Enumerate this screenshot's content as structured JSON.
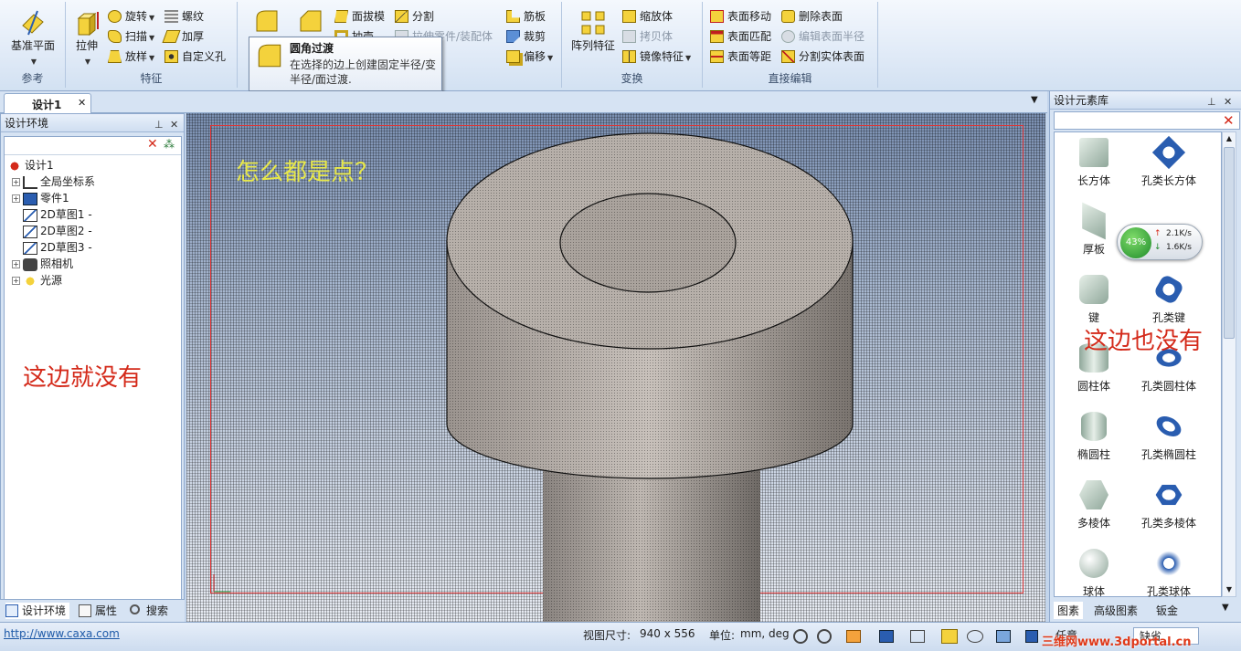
{
  "ribbon": {
    "groups": [
      {
        "label": "参考"
      },
      {
        "label": "特征"
      },
      {
        "label": "变换"
      },
      {
        "label": "直接编辑"
      }
    ],
    "reference_btn": "基准平面",
    "extrude_btn": "拉伸",
    "rotate_btn": "旋转",
    "sweep_btn": "扫描",
    "loft_btn": "放样",
    "thread_btn": "螺纹",
    "thicken_btn": "加厚",
    "custom_hole_btn": "自定义孔",
    "draft_btn": "面拔模",
    "split_btn": "分割",
    "extract_btn": "抽壳",
    "stretch_part_btn": "拉伸零件/装配体",
    "rib_btn": "筋板",
    "trim_btn": "裁剪",
    "offset_btn": "偏移",
    "pattern_btn": "阵列特征",
    "scale_btn": "缩放体",
    "copy_btn": "拷贝体",
    "mirror_btn": "镜像特征",
    "face_move_btn": "表面移动",
    "face_match_btn": "表面匹配",
    "face_offset_btn": "表面等距",
    "delete_face_btn": "删除表面",
    "edit_radius_btn": "编辑表面半径",
    "split_solid_btn": "分割实体表面"
  },
  "tooltip": {
    "title": "圆角过渡",
    "description": "在选择的边上创建固定半径/变半径/面过渡."
  },
  "doc_tab": {
    "label": "设计1"
  },
  "left_panel": {
    "title": "设计环境",
    "tree": [
      {
        "label": "设计1"
      },
      {
        "label": "全局坐标系"
      },
      {
        "label": "零件1"
      },
      {
        "label": "2D草图1 -"
      },
      {
        "label": "2D草图2 -"
      },
      {
        "label": "2D草图3 -"
      },
      {
        "label": "照相机"
      },
      {
        "label": "光源"
      }
    ],
    "annotation": "这边就没有",
    "bottom_tabs": [
      {
        "label": "设计环境"
      },
      {
        "label": "属性"
      },
      {
        "label": "搜索"
      }
    ]
  },
  "viewport": {
    "annotation": "怎么都是点？"
  },
  "right_panel": {
    "title": "设计元素库",
    "items": [
      {
        "label": "长方体"
      },
      {
        "label": "孔类长方体"
      },
      {
        "label": "厚板"
      },
      {
        "label": "键"
      },
      {
        "label": "孔类键"
      },
      {
        "label": "圆柱体"
      },
      {
        "label": "孔类圆柱体"
      },
      {
        "label": "椭圆柱"
      },
      {
        "label": "孔类椭圆柱"
      },
      {
        "label": "多棱体"
      },
      {
        "label": "孔类多棱体"
      },
      {
        "label": "球体"
      },
      {
        "label": "孔类球体"
      }
    ],
    "annotation": "这边也没有",
    "network": {
      "percent": "43%",
      "up": "2.1K/s",
      "down": "1.6K/s"
    },
    "bottom_tabs": [
      {
        "label": "图素"
      },
      {
        "label": "高级图素"
      },
      {
        "label": "钣金"
      }
    ]
  },
  "status_bar": {
    "url": "http://www.caxa.com",
    "view_size_label": "视图尺寸:",
    "view_size_value": "940 x 556",
    "units_label": "单位:",
    "units_value": "mm, deg",
    "mode_value": "任意",
    "default_value": "缺省",
    "watermark": "三维网www.3dportal.cn"
  },
  "colors": {
    "accent": "#1e5aa8",
    "annotation_red": "#d42a1a",
    "annotation_yellow": "#e8e84a"
  }
}
